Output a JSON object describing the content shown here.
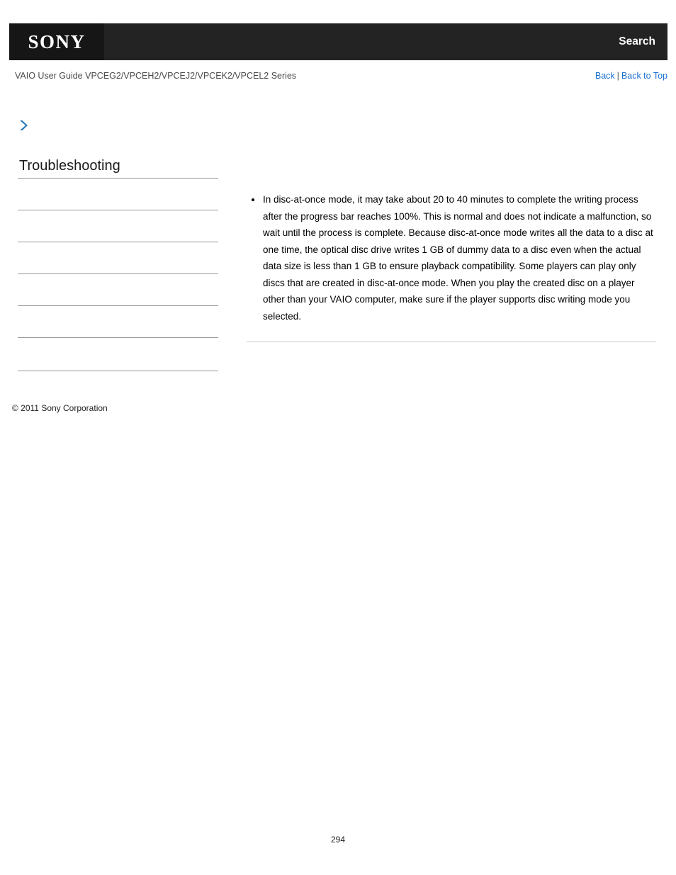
{
  "header": {
    "logo_text": "SONY",
    "search_label": "Search",
    "logo_bg": "#161616",
    "bar_bg": "#232323"
  },
  "subheader": {
    "guide_title": "VAIO User Guide VPCEG2/VPCEH2/VPCEJ2/VPCEK2/VPCEL2 Series",
    "back_label": "Back",
    "separator": "|",
    "back_to_top_label": "Back to Top",
    "link_color": "#1a6fd4"
  },
  "sidebar": {
    "chevron_icon": "chevron-right-icon",
    "chevron_color": "#2a7ab9",
    "title": "Troubleshooting",
    "items": [
      {
        "label": ""
      },
      {
        "label": ""
      },
      {
        "label": ""
      },
      {
        "label": ""
      },
      {
        "label": ""
      },
      {
        "label": ""
      }
    ],
    "copyright": "© 2011 Sony Corporation"
  },
  "content": {
    "bullets": [
      "In disc-at-once mode, it may take about 20 to 40 minutes to complete the writing process after the progress bar reaches 100%. This is normal and does not indicate a malfunction, so wait until the process is complete.\nBecause disc-at-once mode writes all the data to a disc at one time, the optical disc drive writes 1 GB of dummy data to a disc even when the actual data size is less than 1 GB to ensure playback compatibility.\nSome players can play only discs that are created in disc-at-once mode. When you play the created disc on a player other than your VAIO computer, make sure if the player supports disc writing mode you selected."
    ]
  },
  "footer": {
    "page_number": "294"
  }
}
